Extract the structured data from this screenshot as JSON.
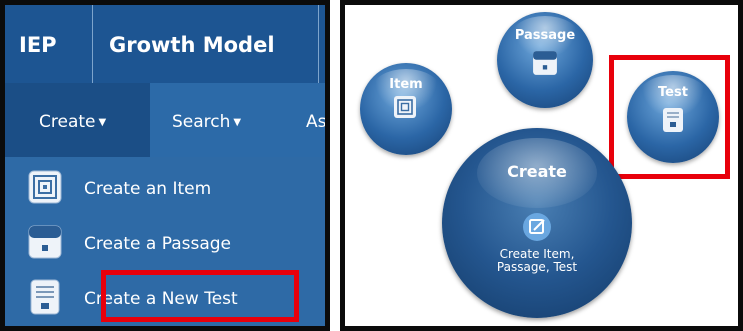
{
  "left": {
    "nav": {
      "iep": "IEP",
      "growth_model": "Growth Model"
    },
    "subnav": {
      "create": "Create",
      "search": "Search",
      "assess": "As"
    },
    "dropdown": {
      "item": "Create an Item",
      "passage": "Create a Passage",
      "test": "Create a New Test"
    }
  },
  "right": {
    "item_label": "Item",
    "passage_label": "Passage",
    "test_label": "Test",
    "create_label": "Create",
    "create_sub_line1": "Create Item,",
    "create_sub_line2": "Passage, Test"
  },
  "colors": {
    "highlight": "#e8000b",
    "nav_blue": "#1d5592",
    "menu_blue": "#2e6aa6"
  }
}
